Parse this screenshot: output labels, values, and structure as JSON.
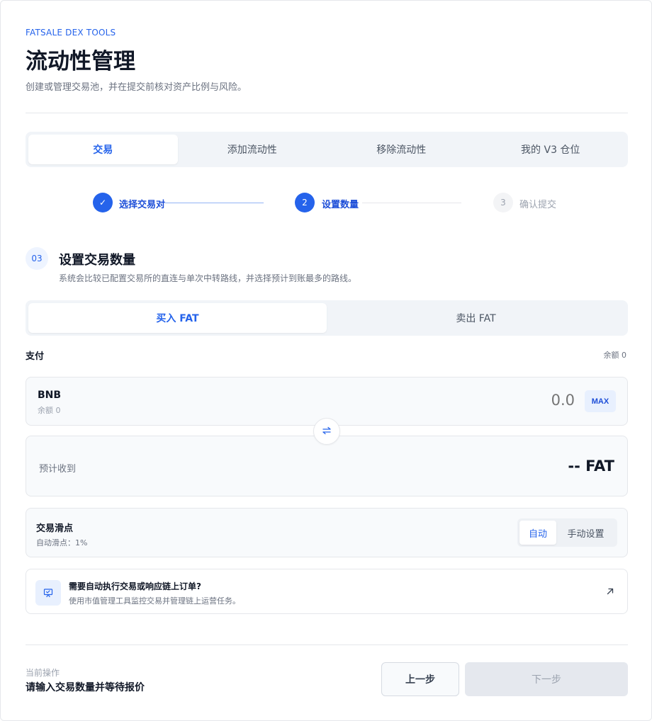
{
  "header": {
    "brand": "FATSALE DEX TOOLS",
    "title": "流动性管理",
    "subtitle": "创建或管理交易池，并在提交前核对资产比例与风险。"
  },
  "tabs": [
    {
      "label": "交易",
      "active": true
    },
    {
      "label": "添加流动性",
      "active": false
    },
    {
      "label": "移除流动性",
      "active": false
    },
    {
      "label": "我的 V3 仓位",
      "active": false
    }
  ],
  "steps": [
    {
      "marker": "✓",
      "label": "选择交易对",
      "state": "done"
    },
    {
      "marker": "2",
      "label": "设置数量",
      "state": "current"
    },
    {
      "marker": "3",
      "label": "确认提交",
      "state": "pending"
    }
  ],
  "section": {
    "number": "03",
    "title": "设置交易数量",
    "description": "系统会比较已配置交易所的直连与单次中转路线，并选择预计到账最多的路线。"
  },
  "trade_direction": {
    "buy_label": "买入 FAT",
    "sell_label": "卖出 FAT",
    "selected": "buy"
  },
  "pay": {
    "label": "支付",
    "balance_text": "余额 0",
    "token": "BNB",
    "token_balance": "余额 0",
    "amount_placeholder": "0.0",
    "max_label": "MAX"
  },
  "receive": {
    "label": "预计收到",
    "value": "-- FAT"
  },
  "slippage": {
    "title": "交易滑点",
    "subtitle": "自动滑点：1%",
    "auto_label": "自动",
    "manual_label": "手动设置",
    "selected": "auto"
  },
  "promo": {
    "icon": "presentation-board-icon",
    "title": "需要自动执行交易或响应链上订单?",
    "subtitle": "使用市值管理工具监控交易并管理链上运营任务。"
  },
  "footer": {
    "current_op_label": "当前操作",
    "current_op_value": "请输入交易数量并等待报价",
    "prev_label": "上一步",
    "next_label": "下一步",
    "next_disabled": true
  },
  "colors": {
    "accent": "#2563eb",
    "muted_bg": "#f1f4f8",
    "border": "#e5e7eb"
  }
}
